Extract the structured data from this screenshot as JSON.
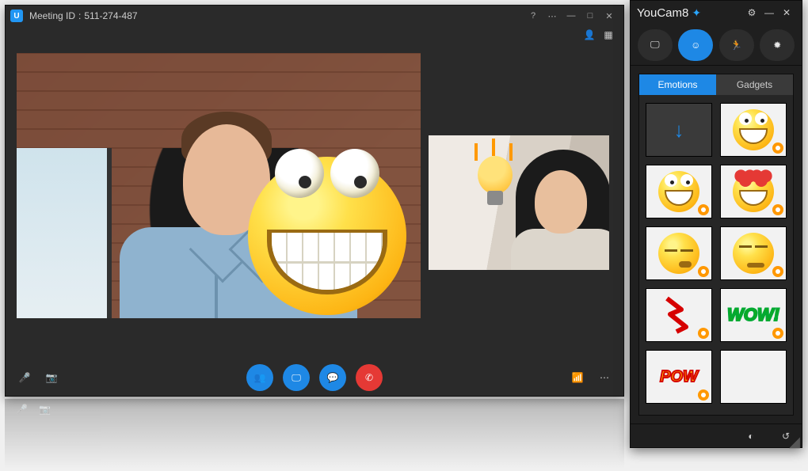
{
  "meeting": {
    "app_icon_letter": "U",
    "title_prefix": "Meeting ID",
    "title_id": "511-274-487",
    "controls": {
      "help": "?",
      "settings_dots": "⋯",
      "minimize": "—",
      "maximize": "□",
      "close": "✕"
    },
    "top_icons": {
      "participant": "👤",
      "grid": "▦"
    },
    "toolbar": {
      "mic": "🎤",
      "camera": "📷",
      "participants": "👥",
      "screen": "🖵",
      "chat": "💬",
      "hangup": "✆",
      "signal": "📶",
      "more": "⋯"
    },
    "overlay_main": "silly-face-emoji",
    "overlay_pip": "lightbulb-idea"
  },
  "youcam": {
    "title": "YouCam",
    "version": "8",
    "plus_icon": "✦",
    "window": {
      "settings": "⚙",
      "minimize": "—",
      "close": "✕"
    },
    "modes": [
      {
        "name": "presentation-mode",
        "glyph": "🖵",
        "active": false
      },
      {
        "name": "emotions-mode",
        "glyph": "☺",
        "active": true
      },
      {
        "name": "avatars-mode",
        "glyph": "🏃",
        "active": false
      },
      {
        "name": "effects-mode",
        "glyph": "✹",
        "active": false
      }
    ],
    "tabs": [
      {
        "label": "Emotions",
        "active": true
      },
      {
        "label": "Gadgets",
        "active": false
      }
    ],
    "items": [
      {
        "name": "download-more",
        "kind": "download",
        "glyph": "↓"
      },
      {
        "name": "emoji-silly",
        "kind": "emoji-silly"
      },
      {
        "name": "emoji-laugh",
        "kind": "emoji-silly"
      },
      {
        "name": "emoji-love",
        "kind": "emoji-love"
      },
      {
        "name": "emoji-sleepy",
        "kind": "emoji-sleepy"
      },
      {
        "name": "emoji-smirk",
        "kind": "emoji-smirk"
      },
      {
        "name": "sticker-crack",
        "kind": "red-zig"
      },
      {
        "name": "sticker-wow",
        "kind": "wow",
        "text": "WOW!"
      },
      {
        "name": "sticker-pow",
        "kind": "pow",
        "text": "POW"
      },
      {
        "name": "sticker-blank",
        "kind": "blank"
      }
    ],
    "footer": {
      "brightness": "◐",
      "reset": "↺"
    }
  }
}
